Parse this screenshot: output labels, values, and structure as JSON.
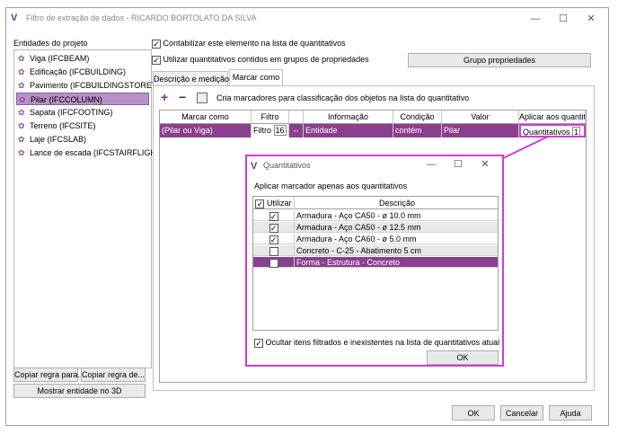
{
  "window": {
    "title": "Filtro de extração de dados - RICARDO BORTOLATO DA SILVA",
    "minimize": "—",
    "maximize": "☐",
    "close": "✕"
  },
  "left": {
    "heading": "Entidades do projeto",
    "entities": [
      {
        "label": "Viga (IFCBEAM)",
        "selected": false
      },
      {
        "label": "Edificação (IFCBUILDING)",
        "selected": false
      },
      {
        "label": "Pavimento (IFCBUILDINGSTOREY)",
        "selected": false
      },
      {
        "label": "Pilar (IFCCOLUMN)",
        "selected": true
      },
      {
        "label": "Sapata (IFCFOOTING)",
        "selected": false
      },
      {
        "label": "Terreno (IFCSITE)",
        "selected": false
      },
      {
        "label": "Laje (IFCSLAB)",
        "selected": false
      },
      {
        "label": "Lance de escada (IFCSTAIRFLIGHT)",
        "selected": false
      }
    ],
    "copy_to": "Copiar regra para...",
    "copy_from": "Copiar regra de...",
    "show3d": "Mostrar entidade no 3D"
  },
  "options": {
    "count_element": "Contabilizar este elemento na lista de quantitativos",
    "use_groups": "Utilizar quantitativos contidos em grupos de propriedades",
    "group_props": "Grupo propriedades"
  },
  "tabs": [
    "Descrição e medição",
    "Marcar como"
  ],
  "marcar": {
    "add": "+",
    "remove": "−",
    "description": "Cria marcadores para classificação dos objetos na lista do quantitativo",
    "headers": [
      "Marcar como",
      "Filtro",
      "",
      "Informação",
      "Condição",
      "Valor",
      "Aplicar aos quantit"
    ],
    "row": {
      "marcar": "(Pilar ou Viga)",
      "filtro": "Filtro",
      "filtro_num": "16",
      "toggle": "⇔",
      "informacao": "Entidade",
      "condicao": "contém",
      "valor": "Pilar",
      "aplicar": "Quantitativos",
      "aplicar_num": "1"
    }
  },
  "dialog": {
    "title": "Quantitativos",
    "subtitle": "Aplicar marcador apenas aos quantitativos",
    "col_use": "Utilizar",
    "col_desc": "Descrição",
    "rows": [
      {
        "desc": "Armadura - Aço CA50 - ø 10.0 mm",
        "checked": true
      },
      {
        "desc": "Armadura - Aço CA50 - ø 12.5 mm",
        "checked": true
      },
      {
        "desc": "Armadura - Aço CA60 - ø 5.0 mm",
        "checked": true
      },
      {
        "desc": "Concreto - C-25 - Abatimento 5 cm",
        "checked": false
      },
      {
        "desc": "Forma - Estrutura - Concreto",
        "checked": true
      }
    ],
    "hide_filtered": "Ocultar itens filtrados e inexistentes na lista de quantitativos atual",
    "ok": "OK",
    "minimize": "—",
    "maximize": "☐",
    "close": "✕"
  },
  "footer": {
    "ok": "OK",
    "cancel": "Cancelar",
    "help": "Ajuda"
  },
  "colors": {
    "accent": "#8b3f8f",
    "highlight": "#d43ad4",
    "selection": "#b88fc8"
  }
}
